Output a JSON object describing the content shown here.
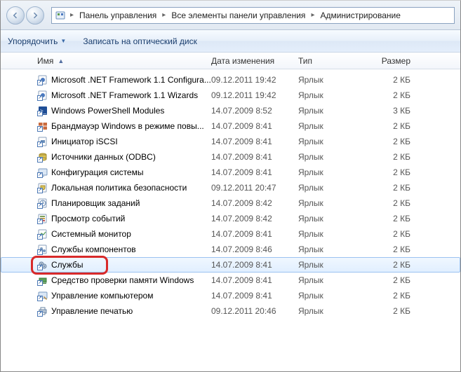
{
  "nav": {
    "crumbs": [
      "Панель управления",
      "Все элементы панели управления",
      "Администрирование"
    ]
  },
  "toolbar": {
    "organize": "Упорядочить",
    "burn": "Записать на оптический диск"
  },
  "headers": {
    "name": "Имя",
    "date": "Дата изменения",
    "type": "Тип",
    "size": "Размер"
  },
  "items": [
    {
      "icon": "cfg",
      "name": "Microsoft .NET Framework 1.1 Configura...",
      "date": "09.12.2011 19:42",
      "type": "Ярлык",
      "size": "2 КБ",
      "sel": false
    },
    {
      "icon": "cfg",
      "name": "Microsoft .NET Framework 1.1 Wizards",
      "date": "09.12.2011 19:42",
      "type": "Ярлык",
      "size": "2 КБ",
      "sel": false
    },
    {
      "icon": "ps",
      "name": "Windows PowerShell Modules",
      "date": "14.07.2009 8:52",
      "type": "Ярлык",
      "size": "3 КБ",
      "sel": false
    },
    {
      "icon": "wall",
      "name": "Брандмауэр Windows в режиме повы...",
      "date": "14.07.2009 8:41",
      "type": "Ярлык",
      "size": "2 КБ",
      "sel": false
    },
    {
      "icon": "iscsi",
      "name": "Инициатор iSCSI",
      "date": "14.07.2009 8:41",
      "type": "Ярлык",
      "size": "2 КБ",
      "sel": false
    },
    {
      "icon": "odbc",
      "name": "Источники данных (ODBC)",
      "date": "14.07.2009 8:41",
      "type": "Ярлык",
      "size": "2 КБ",
      "sel": false
    },
    {
      "icon": "sys",
      "name": "Конфигурация системы",
      "date": "14.07.2009 8:41",
      "type": "Ярлык",
      "size": "2 КБ",
      "sel": false
    },
    {
      "icon": "pol",
      "name": "Локальная политика безопасности",
      "date": "09.12.2011 20:47",
      "type": "Ярлык",
      "size": "2 КБ",
      "sel": false
    },
    {
      "icon": "task",
      "name": "Планировщик заданий",
      "date": "14.07.2009 8:42",
      "type": "Ярлык",
      "size": "2 КБ",
      "sel": false
    },
    {
      "icon": "event",
      "name": "Просмотр событий",
      "date": "14.07.2009 8:42",
      "type": "Ярлык",
      "size": "2 КБ",
      "sel": false
    },
    {
      "icon": "perf",
      "name": "Системный монитор",
      "date": "14.07.2009 8:41",
      "type": "Ярлык",
      "size": "2 КБ",
      "sel": false
    },
    {
      "icon": "comp",
      "name": "Службы компонентов",
      "date": "14.07.2009 8:46",
      "type": "Ярлык",
      "size": "2 КБ",
      "sel": false
    },
    {
      "icon": "gears",
      "name": "Службы",
      "date": "14.07.2009 8:41",
      "type": "Ярлык",
      "size": "2 КБ",
      "sel": true,
      "hl": true
    },
    {
      "icon": "mem",
      "name": "Средство проверки памяти Windows",
      "date": "14.07.2009 8:41",
      "type": "Ярлык",
      "size": "2 КБ",
      "sel": false
    },
    {
      "icon": "mgmt",
      "name": "Управление компьютером",
      "date": "14.07.2009 8:41",
      "type": "Ярлык",
      "size": "2 КБ",
      "sel": false
    },
    {
      "icon": "print",
      "name": "Управление печатью",
      "date": "09.12.2011 20:46",
      "type": "Ярлык",
      "size": "2 КБ",
      "sel": false
    }
  ]
}
